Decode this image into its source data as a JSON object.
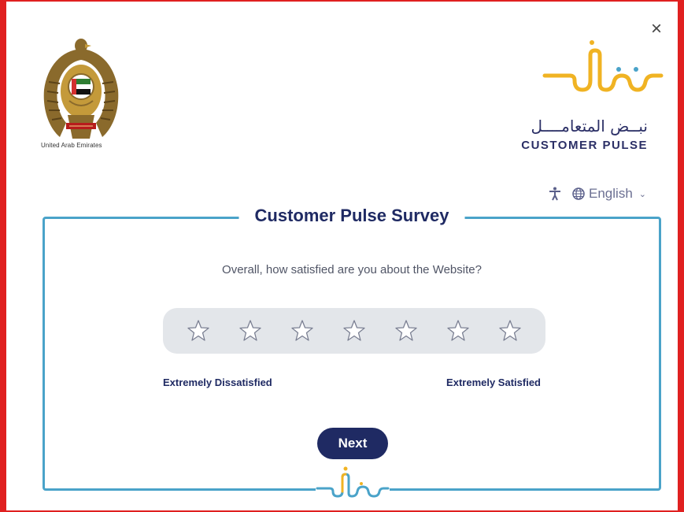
{
  "window": {
    "close_label": "×"
  },
  "header": {
    "uae_caption": "United Arab Emirates",
    "brand_arabic": "نبــض المتعامــــل",
    "brand_english": "CUSTOMER PULSE"
  },
  "tools": {
    "accessibility_icon": "accessibility-icon",
    "globe_icon": "globe-icon",
    "language_label": "English",
    "chevron": "⌄"
  },
  "survey": {
    "title": "Customer Pulse Survey",
    "question": "Overall, how satisfied are you about the Website?",
    "rating_count": 7,
    "scale_low_label": "Extremely Dissatisfied",
    "scale_high_label": "Extremely Satisfied",
    "next_label": "Next"
  },
  "colors": {
    "frame": "#e02020",
    "accent_gold": "#f0b323",
    "accent_blue": "#4aa3c9",
    "navy": "#1f2a63",
    "star_bg": "#e3e6ea"
  }
}
